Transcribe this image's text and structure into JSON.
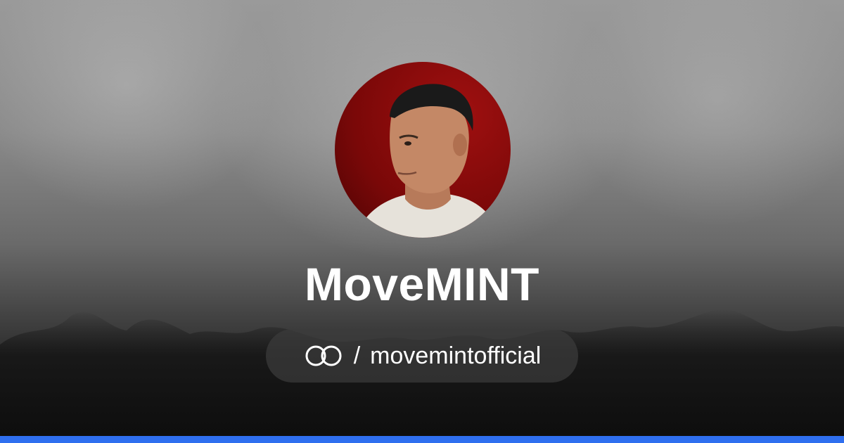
{
  "profile": {
    "display_name": "MoveMINT",
    "separator": "/",
    "handle": "movemintofficial",
    "avatar_alt": "profile-photo",
    "platform_icon": "linked-rings-icon"
  },
  "colors": {
    "avatar_background": "#8a0a0a",
    "bottom_bar": "#2f6fef",
    "text": "#ffffff"
  }
}
